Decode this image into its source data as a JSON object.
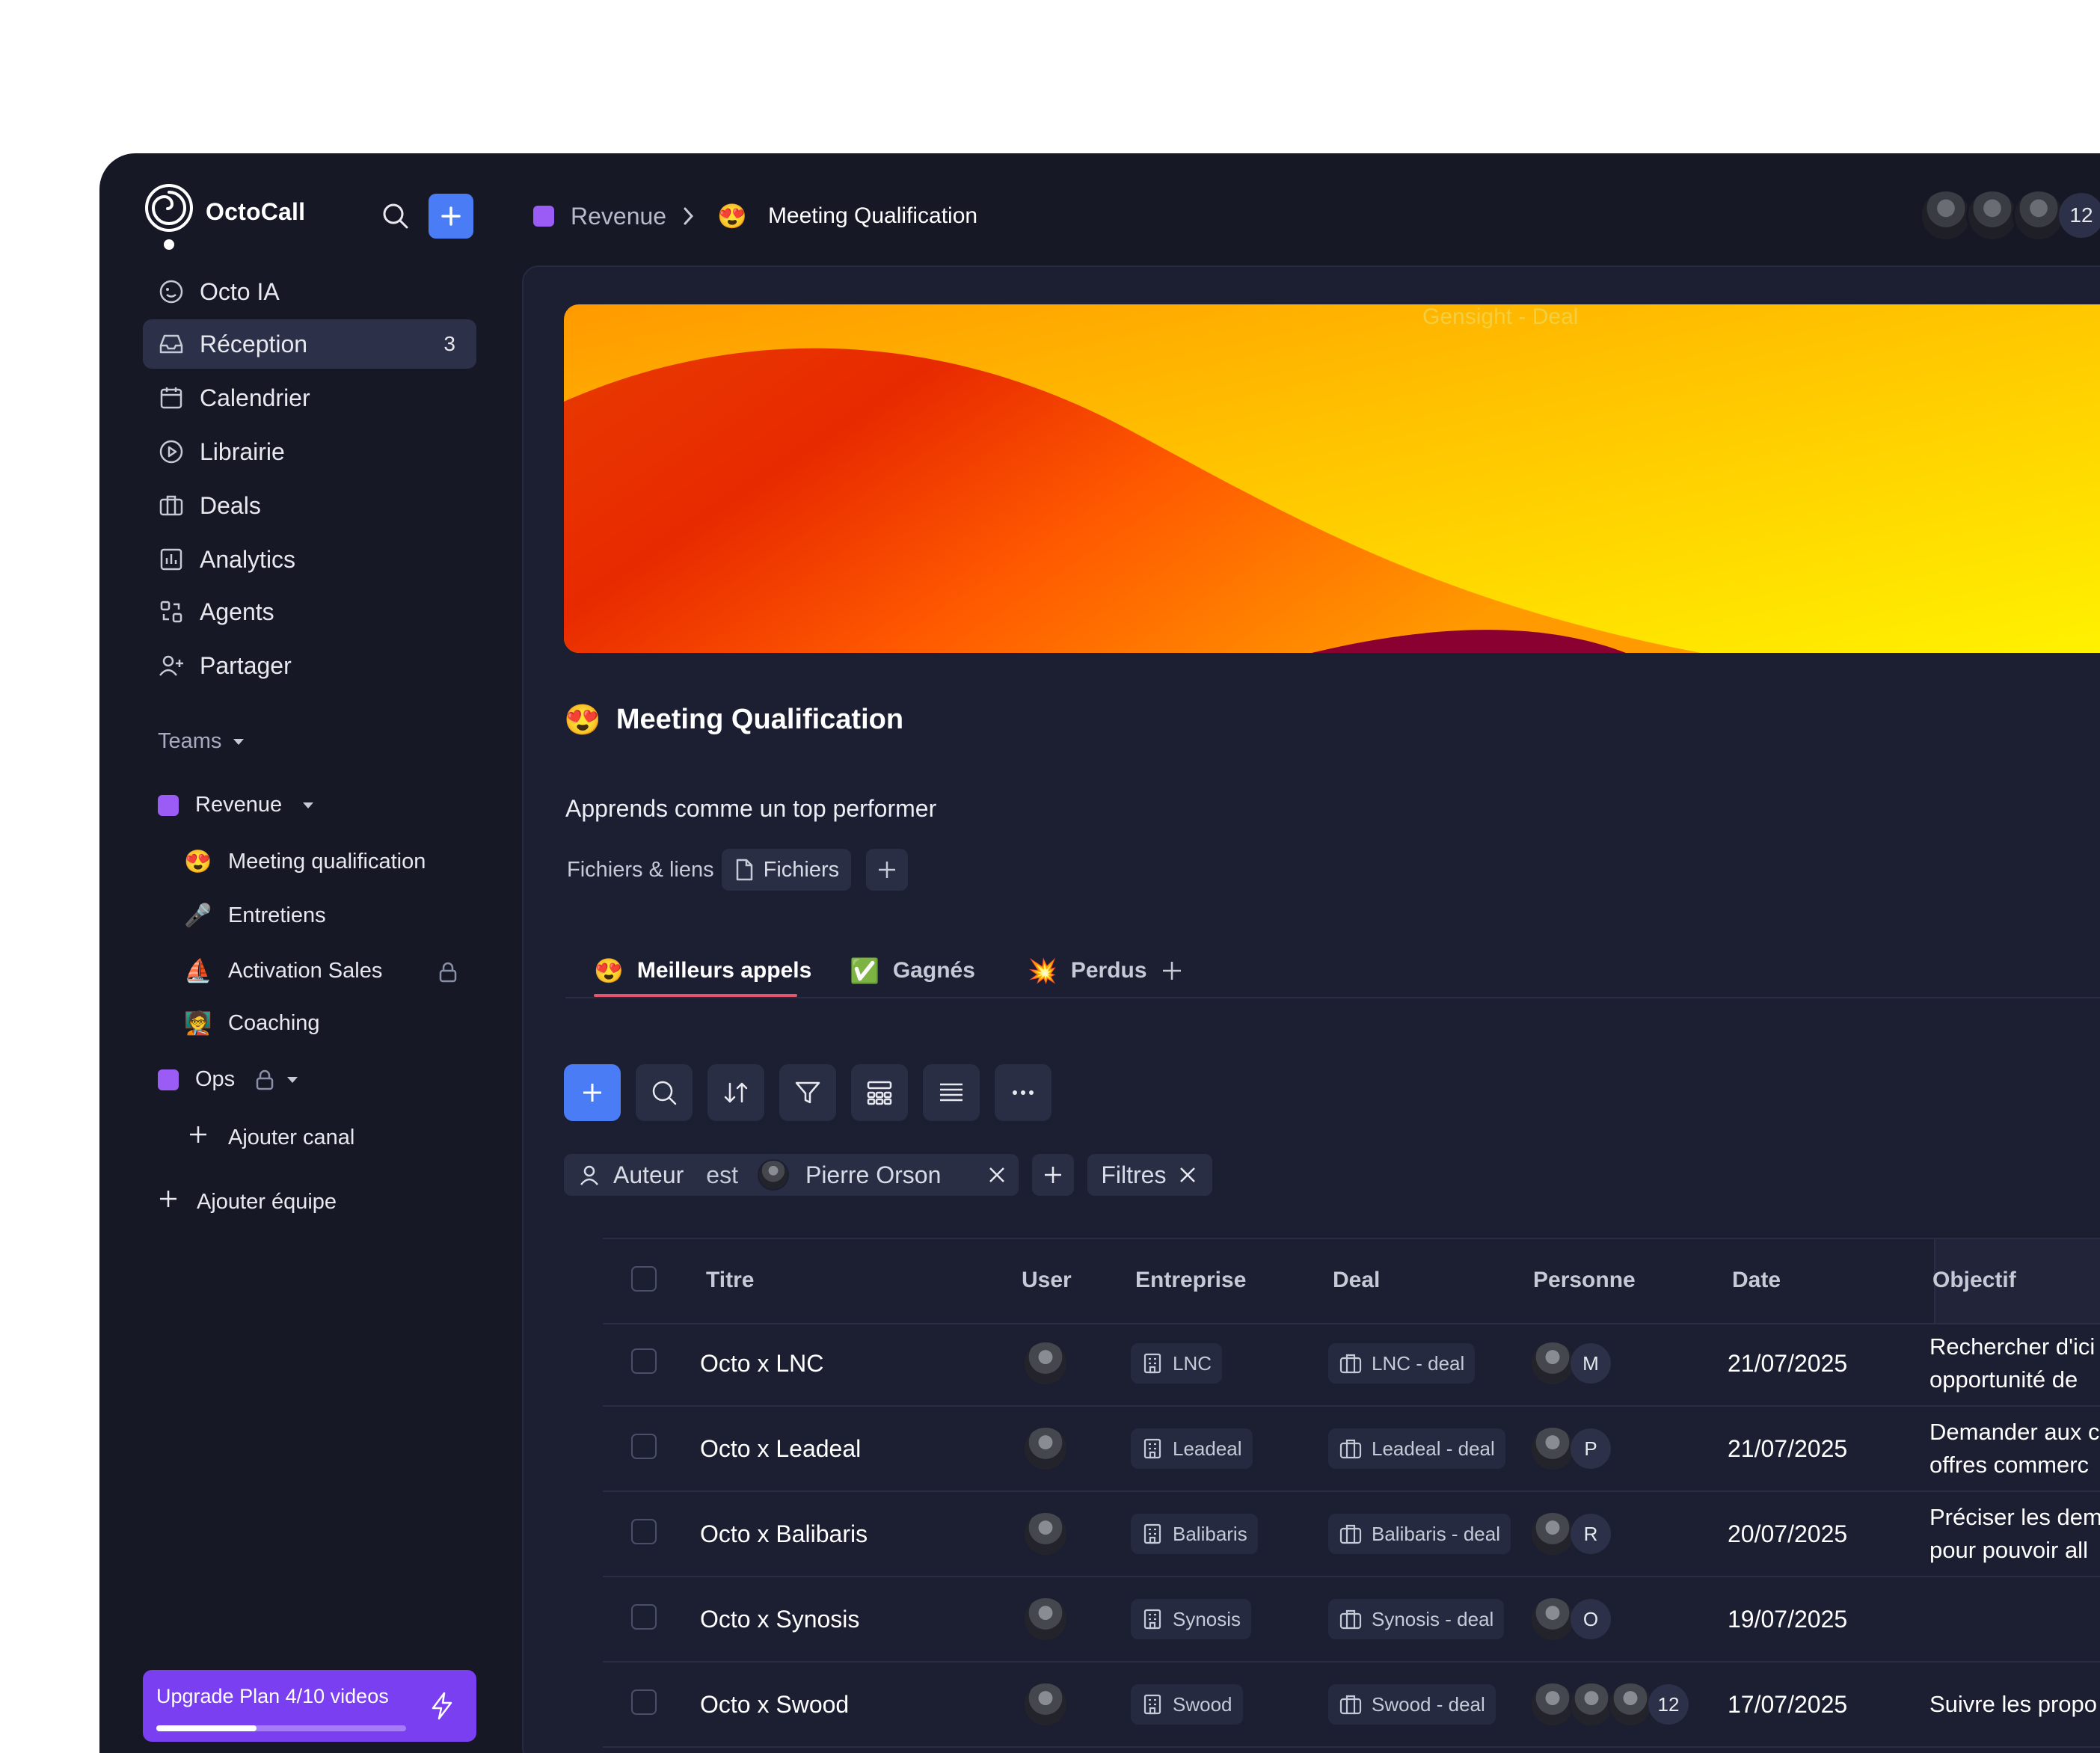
{
  "app": {
    "brand": "OctoCall"
  },
  "sidebar": {
    "nav": [
      {
        "label": "Octo IA",
        "icon": "octo-ia-icon"
      },
      {
        "label": "Réception",
        "icon": "inbox-icon",
        "count": "3",
        "active": true
      },
      {
        "label": "Calendrier",
        "icon": "calendar-icon"
      },
      {
        "label": "Librairie",
        "icon": "play-circle-icon"
      },
      {
        "label": "Deals",
        "icon": "briefcase-icon"
      },
      {
        "label": "Analytics",
        "icon": "analytics-icon"
      },
      {
        "label": "Agents",
        "icon": "agents-icon"
      },
      {
        "label": "Partager",
        "icon": "user-plus-icon"
      }
    ],
    "teams_label": "Teams",
    "teams": [
      {
        "name": "Revenue",
        "color": "#9b5cf5"
      },
      {
        "name": "Ops",
        "color": "#9b5cf5"
      }
    ],
    "channels": [
      {
        "emoji": "😍",
        "label": "Meeting qualification"
      },
      {
        "emoji": "🎤",
        "label": "Entretiens"
      },
      {
        "emoji": "⛵",
        "label": "Activation Sales",
        "locked": true
      },
      {
        "emoji": "🧑‍🏫",
        "label": "Coaching"
      }
    ],
    "add_channel": "Ajouter canal",
    "add_team": "Ajouter équipe",
    "upgrade": {
      "label": "Upgrade Plan 4/10 videos",
      "progress": 0.4
    }
  },
  "breadcrumb": {
    "team": "Revenue",
    "emoji": "😍",
    "page": "Meeting Qualification"
  },
  "members": {
    "count": "12"
  },
  "banner": {
    "label": "Gensight - Deal"
  },
  "page": {
    "emoji": "😍",
    "title": "Meeting Qualification",
    "description": "Apprends comme un top performer",
    "files_label": "Fichiers & liens",
    "files_chip": "Fichiers"
  },
  "tabs": [
    {
      "emoji": "😍",
      "label": "Meilleurs appels",
      "active": true
    },
    {
      "emoji": "✅",
      "label": "Gagnés"
    },
    {
      "emoji": "💥",
      "label": "Perdus"
    }
  ],
  "filter": {
    "field": "Auteur",
    "op": "est",
    "value": "Pierre Orson",
    "filters_label": "Filtres"
  },
  "table": {
    "columns": [
      "Titre",
      "User",
      "Entreprise",
      "Deal",
      "Personne",
      "Date",
      "Objectif"
    ],
    "rows": [
      {
        "title": "Octo x LNC",
        "company": "LNC",
        "deal": "LNC - deal",
        "person_letter": "M",
        "date": "21/07/2025",
        "objective": [
          "Rechercher d'ici",
          "opportunité de"
        ]
      },
      {
        "title": "Octo x Leadeal",
        "company": "Leadeal",
        "deal": "Leadeal - deal",
        "person_letter": "P",
        "date": "21/07/2025",
        "objective": [
          "Demander aux c",
          "offres commerc"
        ]
      },
      {
        "title": "Octo x Balibaris",
        "company": "Balibaris",
        "deal": "Balibaris - deal",
        "person_letter": "R",
        "date": "20/07/2025",
        "objective": [
          "Préciser les dem",
          "pour pouvoir all"
        ]
      },
      {
        "title": "Octo x Synosis",
        "company": "Synosis",
        "deal": "Synosis - deal",
        "person_letter": "O",
        "date": "19/07/2025",
        "objective": [
          "",
          ""
        ]
      },
      {
        "title": "Octo x Swood",
        "company": "Swood",
        "deal": "Swood - deal",
        "person_letter": "12",
        "date": "17/07/2025",
        "objective": [
          "Suivre les propo",
          ""
        ]
      }
    ]
  }
}
